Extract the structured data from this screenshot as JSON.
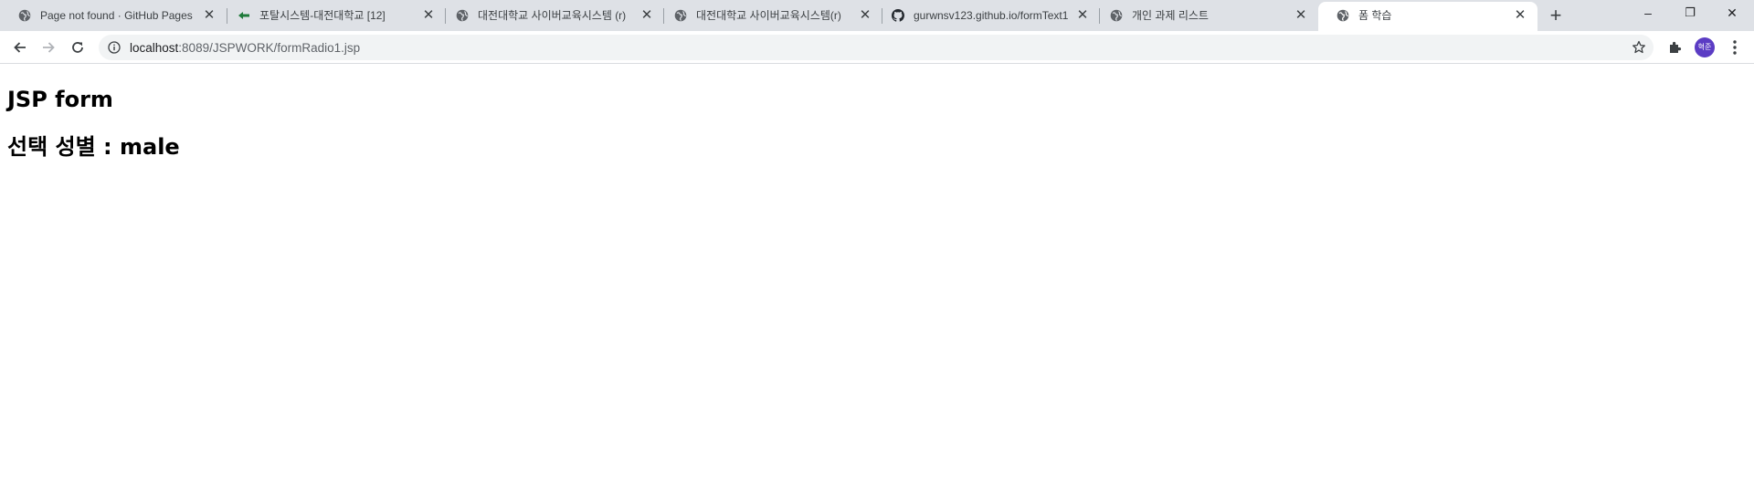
{
  "browser": {
    "tabs": [
      {
        "title": "Page not found · GitHub Pages",
        "icon": "globe-icon"
      },
      {
        "title": "포탈시스템-대전대학교 [12]",
        "icon": "green-leaf-icon"
      },
      {
        "title": "대전대학교 사이버교육시스템 (r)",
        "icon": "globe-icon"
      },
      {
        "title": "대전대학교 사이버교육시스템(r)",
        "icon": "globe-icon"
      },
      {
        "title": "gurwnsv123.github.io/formText1",
        "icon": "github-icon"
      },
      {
        "title": "개인 과제 리스트",
        "icon": "globe-icon"
      },
      {
        "title": "폼 학습",
        "icon": "globe-icon",
        "active": true
      }
    ],
    "tab_close_glyph": "✕",
    "new_tab_glyph": "+",
    "window_controls": {
      "minimize": "–",
      "restore": "❐",
      "close": "✕"
    },
    "address": {
      "host": "localhost",
      "path": ":8089/JSPWORK/formRadio1.jsp"
    },
    "profile_initials": "혁준"
  },
  "page": {
    "title": "JSP form",
    "result_label": "선택 성별 : ",
    "result_value": "male"
  },
  "colors": {
    "tabstrip": "#dee1e6",
    "avatar": "#5b3cc4",
    "portal_icon": "#1e7a3a"
  }
}
